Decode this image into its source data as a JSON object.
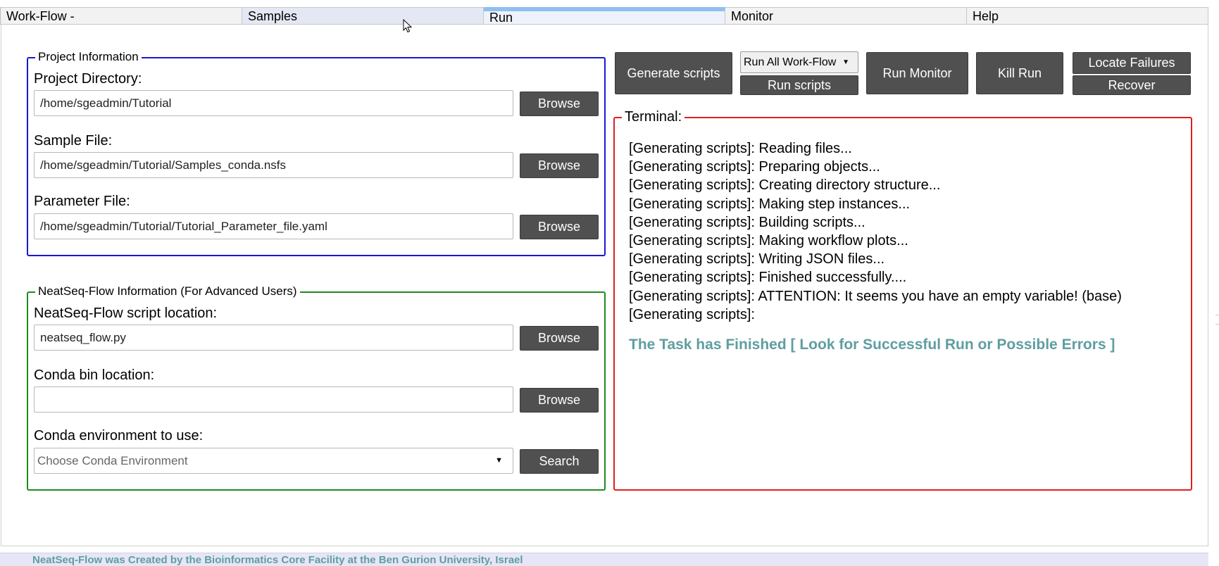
{
  "tabs": [
    {
      "label": "Work-Flow -"
    },
    {
      "label": "Samples"
    },
    {
      "label": "Run"
    },
    {
      "label": "Monitor"
    },
    {
      "label": "Help"
    }
  ],
  "active_tab": "Run",
  "project": {
    "legend": "Project Information",
    "directory_label": "Project Directory:",
    "directory_value": "/home/sgeadmin/Tutorial",
    "sample_label": "Sample File:",
    "sample_value": "/home/sgeadmin/Tutorial/Samples_conda.nsfs",
    "parameter_label": "Parameter File:",
    "parameter_value": "/home/sgeadmin/Tutorial/Tutorial_Parameter_file.yaml",
    "browse_label": "Browse"
  },
  "neatseq": {
    "legend": "NeatSeq-Flow Information (For Advanced Users)",
    "script_label": "NeatSeq-Flow script location:",
    "script_value": "neatseq_flow.py",
    "conda_bin_label": "Conda bin location:",
    "conda_bin_value": "",
    "conda_env_label": "Conda environment to use:",
    "conda_env_placeholder": "Choose Conda Environment",
    "browse_label": "Browse",
    "search_label": "Search"
  },
  "toolbar": {
    "generate_label": "Generate scripts",
    "workflow_select_value": "Run All Work-Flow",
    "run_scripts_label": "Run scripts",
    "run_monitor_label": "Run Monitor",
    "kill_run_label": "Kill Run",
    "locate_failures_label": "Locate Failures",
    "recover_label": "Recover"
  },
  "terminal": {
    "legend": "Terminal:",
    "lines": [
      "[Generating scripts]: Reading files...",
      "[Generating scripts]: Preparing objects...",
      "[Generating scripts]: Creating directory structure...",
      "[Generating scripts]: Making step instances...",
      "[Generating scripts]: Building scripts...",
      "[Generating scripts]: Making workflow plots...",
      "[Generating scripts]: Writing JSON files...",
      "[Generating scripts]: Finished successfully....",
      "[Generating scripts]: ATTENTION: It seems you have an empty variable! (base)",
      "[Generating scripts]:"
    ],
    "status": "The Task has Finished [ Look for Successful Run or Possible Errors ]"
  },
  "footer": {
    "text": "NeatSeq-Flow was Created by the Bioinformatics Core Facility at the Ben Gurion University, Israel"
  },
  "colors": {
    "tab_active_indicator": "#8fc0ee",
    "project_border": "#1919d2",
    "neatseq_border": "#1e8c1e",
    "terminal_border": "#e01f1f",
    "button_bg": "#505050",
    "status_text": "#5f9ea0",
    "footer_bg": "#e6e6f7"
  }
}
